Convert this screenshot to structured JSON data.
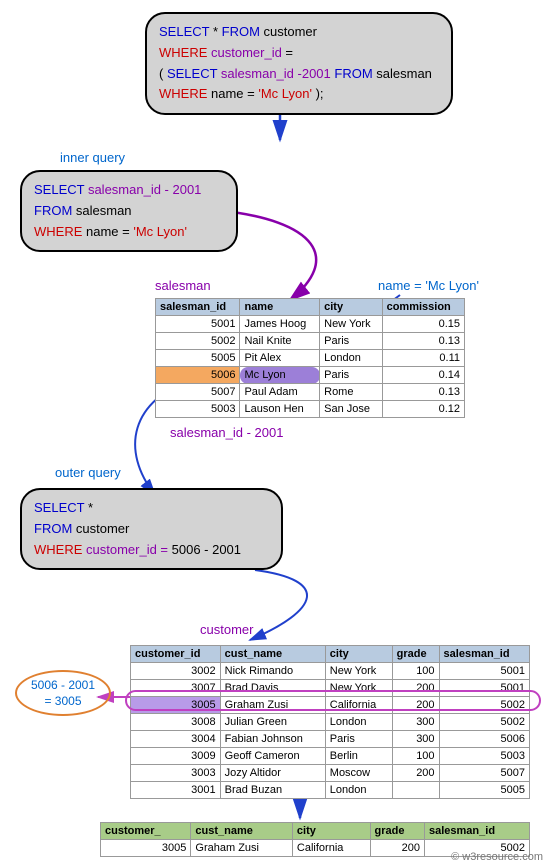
{
  "query1": {
    "line1a": "SELECT ",
    "line1b": "* ",
    "line1c": "FROM ",
    "line1d": "customer",
    "line2a": "WHERE ",
    "line2b": "customer_id ",
    "line2c": "=",
    "line3a": "( ",
    "line3b": "SELECT ",
    "line3c": "salesman_id -2001 ",
    "line3d": "FROM ",
    "line3e": "salesman",
    "line4a": "WHERE ",
    "line4b": "name = ",
    "line4c": "'Mc Lyon' ",
    "line4d": ");"
  },
  "labels": {
    "inner_query": "inner query",
    "outer_query": "outer query",
    "salesman": "salesman",
    "customer": "customer",
    "name_eq": "name = 'Mc Lyon'",
    "sid_expr": "salesman_id - 2001"
  },
  "query2": {
    "line1a": "SELECT ",
    "line1b": "salesman_id - 2001",
    "line2a": "FROM ",
    "line2b": "salesman",
    "line3a": "WHERE ",
    "line3b": "name = ",
    "line3c": "'Mc Lyon'"
  },
  "query3": {
    "line1a": "SELECT ",
    "line1b": "*",
    "line2a": "FROM ",
    "line2b": "customer",
    "line3a": "WHERE ",
    "line3b": "customer_id = ",
    "line3c": "5006 - 2001"
  },
  "salesman_headers": [
    "salesman_id",
    "name",
    "city",
    "commission"
  ],
  "salesman_rows": [
    [
      "5001",
      "James Hoog",
      "New York",
      "0.15"
    ],
    [
      "5002",
      "Nail Knite",
      "Paris",
      "0.13"
    ],
    [
      "5005",
      "Pit Alex",
      "London",
      "0.11"
    ],
    [
      "5006",
      "Mc Lyon",
      "Paris",
      "0.14"
    ],
    [
      "5007",
      "Paul Adam",
      "Rome",
      "0.13"
    ],
    [
      "5003",
      "Lauson Hen",
      "San Jose",
      "0.12"
    ]
  ],
  "customer_headers": [
    "customer_id",
    "cust_name",
    "city",
    "grade",
    "salesman_id"
  ],
  "customer_rows": [
    [
      "3002",
      "Nick Rimando",
      "New York",
      "100",
      "5001"
    ],
    [
      "3007",
      "Brad Davis",
      "New York",
      "200",
      "5001"
    ],
    [
      "3005",
      "Graham Zusi",
      "California",
      "200",
      "5002"
    ],
    [
      "3008",
      "Julian Green",
      "London",
      "300",
      "5002"
    ],
    [
      "3004",
      "Fabian Johnson",
      "Paris",
      "300",
      "5006"
    ],
    [
      "3009",
      "Geoff Cameron",
      "Berlin",
      "100",
      "5003"
    ],
    [
      "3003",
      "Jozy Altidor",
      "Moscow",
      "200",
      "5007"
    ],
    [
      "3001",
      "Brad Buzan",
      "London",
      "",
      "5005"
    ]
  ],
  "result_headers": [
    "customer_",
    "cust_name",
    "city",
    "grade",
    "salesman_id"
  ],
  "result_row": [
    "3005",
    "Graham Zusi",
    "California",
    "200",
    "5002"
  ],
  "oval_note_l1": "5006 - 2001",
  "oval_note_l2": "= 3005",
  "watermark": "© w3resource.com"
}
